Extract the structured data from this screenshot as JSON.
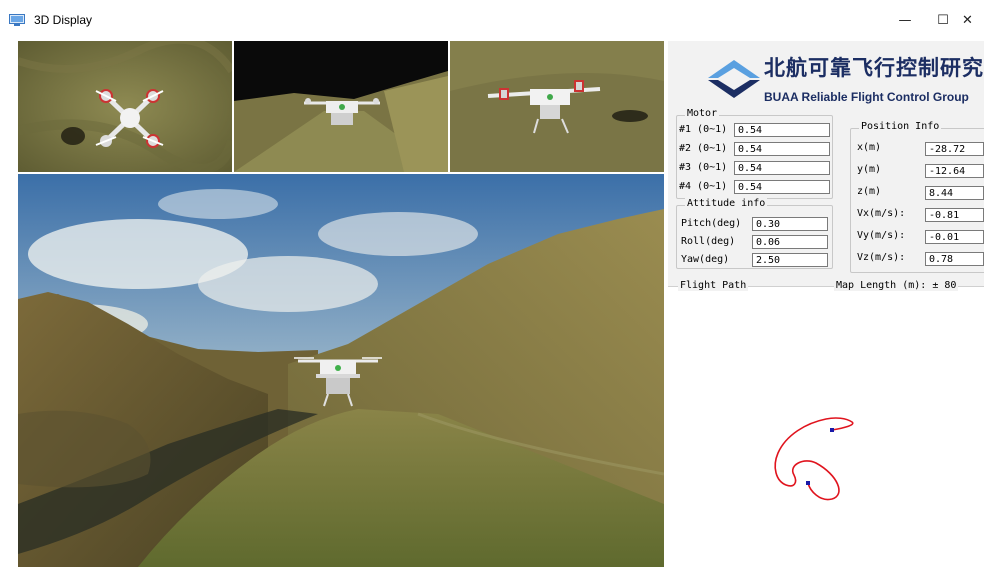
{
  "window": {
    "title": "3D Display",
    "minimize_glyph": "—",
    "maximize_glyph": "☐",
    "close_glyph": "✕"
  },
  "logo": {
    "chinese": "北航可靠飞行控制研究组",
    "english": "BUAA  Reliable Flight Control Group"
  },
  "motor": {
    "title": "Motor",
    "rows": [
      {
        "label": "#1 (0~1)",
        "value": "0.54"
      },
      {
        "label": "#2 (0~1)",
        "value": "0.54"
      },
      {
        "label": "#3 (0~1)",
        "value": "0.54"
      },
      {
        "label": "#4 (0~1)",
        "value": "0.54"
      }
    ]
  },
  "attitude": {
    "title": "Attitude info",
    "rows": [
      {
        "label": "Pitch(deg)",
        "value": "0.30"
      },
      {
        "label": "Roll(deg)",
        "value": "0.06"
      },
      {
        "label": "Yaw(deg)",
        "value": "2.50"
      }
    ]
  },
  "position": {
    "title": "Position Info",
    "rows": [
      {
        "label": "x(m)",
        "value": "-28.72"
      },
      {
        "label": "y(m)",
        "value": "-12.64"
      },
      {
        "label": "z(m)",
        "value": "8.44"
      },
      {
        "label": "Vx(m/s):",
        "value": "-0.81"
      },
      {
        "label": "Vy(m/s):",
        "value": "-0.01"
      },
      {
        "label": "Vz(m/s):",
        "value": "0.78"
      }
    ]
  },
  "flight_path": {
    "label": "Flight Path",
    "map_length": "Map Length (m): ± 80",
    "path_color": "#e0141e",
    "marker_color": "#1a1aa8"
  },
  "icons": {
    "app": "3d-display-window-icon",
    "logo_mark": "chevron-logo-icon"
  },
  "colors": {
    "logo_text": "#1c2e63",
    "logo_light": "#5aa0e0",
    "panel_bg": "#f2f2f2"
  }
}
